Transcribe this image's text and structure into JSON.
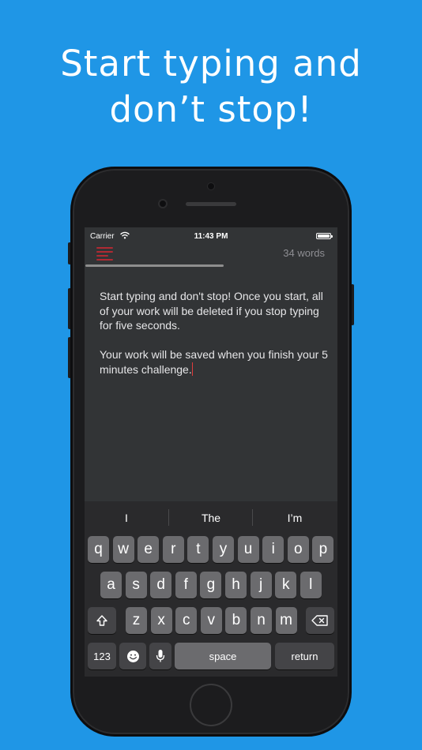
{
  "headline": {
    "line1": "Start typing and",
    "line2": "don’t stop!"
  },
  "status_bar": {
    "carrier": "Carrier",
    "time": "11:43 PM",
    "wifi_icon": "wifi-icon",
    "battery_icon": "battery-icon"
  },
  "toolbar": {
    "menu_icon": "hamburger-menu-icon",
    "word_count": "34 words",
    "progress": 0.55,
    "accent_color": "#b02a33"
  },
  "editor": {
    "paragraph1": "Start typing and don't stop! Once you start, all of your work will be deleted if you stop typing for five seconds.",
    "paragraph2": "Your work will be saved when you finish your 5 minutes challenge."
  },
  "keyboard": {
    "suggestions": [
      "I",
      "The",
      "I’m"
    ],
    "row1": [
      "q",
      "w",
      "e",
      "r",
      "t",
      "y",
      "u",
      "i",
      "o",
      "p"
    ],
    "row2": [
      "a",
      "s",
      "d",
      "f",
      "g",
      "h",
      "j",
      "k",
      "l"
    ],
    "row3": [
      "z",
      "x",
      "c",
      "v",
      "b",
      "n",
      "m"
    ],
    "shift_icon": "shift-icon",
    "delete_icon": "backspace-icon",
    "numbers_label": "123",
    "emoji_icon": "emoji-icon",
    "mic_icon": "microphone-icon",
    "space_label": "space",
    "return_label": "return"
  },
  "colors": {
    "background": "#1f96e6",
    "screen": "#323436",
    "caret": "#e03c3c"
  }
}
